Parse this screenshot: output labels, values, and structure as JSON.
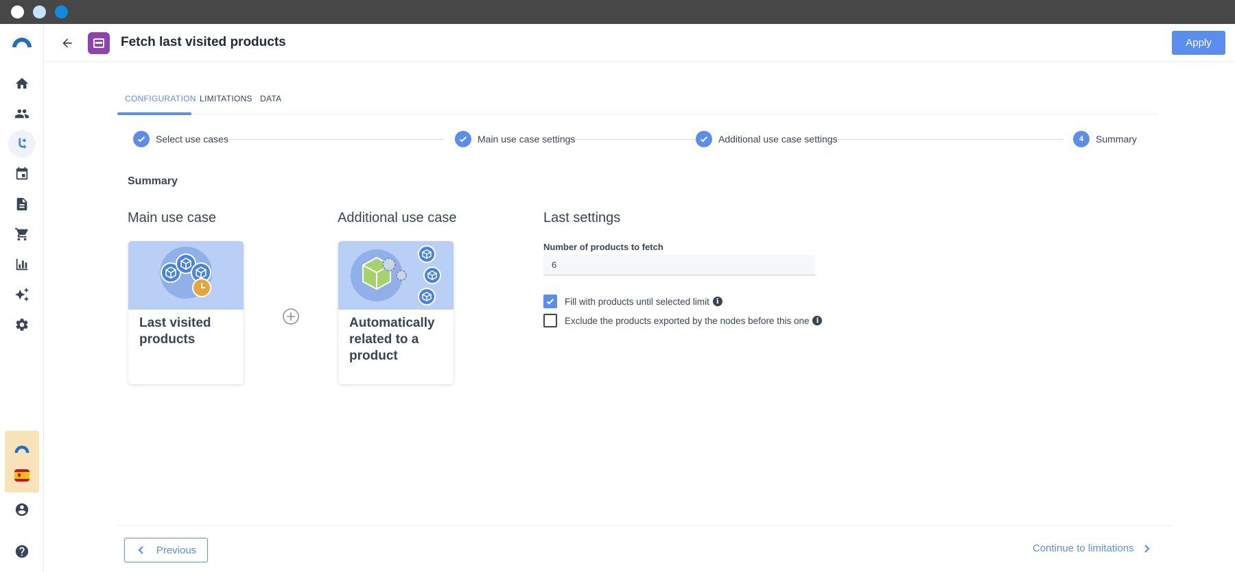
{
  "window": {
    "buttons": [
      "close",
      "minimize",
      "maximize"
    ]
  },
  "sidebar": {
    "logo_icon": "brand-arc-icon",
    "items": [
      {
        "icon": "home-icon"
      },
      {
        "icon": "people-icon"
      },
      {
        "icon": "flow-branch-icon",
        "active": true
      },
      {
        "icon": "calendar-icon"
      },
      {
        "icon": "document-icon"
      },
      {
        "icon": "cart-icon"
      },
      {
        "icon": "bar-chart-icon"
      },
      {
        "icon": "sparkles-icon"
      },
      {
        "icon": "gear-icon"
      }
    ],
    "bottom": [
      {
        "icon": "account-circle-icon"
      },
      {
        "icon": "help-icon"
      }
    ],
    "promo": {
      "flag": "spain-flag"
    }
  },
  "header": {
    "title": "Fetch last visited products",
    "apply_label": "Apply",
    "node_icon": "credit-card-icon",
    "node_color": "#8e44ad"
  },
  "tabs": [
    {
      "label": "CONFIGURATION",
      "active": true
    },
    {
      "label": "LIMITATIONS",
      "active": false
    },
    {
      "label": "DATA",
      "active": false
    }
  ],
  "stepper": {
    "steps": [
      {
        "label": "Select use cases",
        "status": "done"
      },
      {
        "label": "Main use case settings",
        "status": "done"
      },
      {
        "label": "Additional use case settings",
        "status": "done"
      },
      {
        "label": "Summary",
        "status": "current",
        "number": "4"
      }
    ]
  },
  "summary": {
    "title": "Summary",
    "main_use_case": {
      "heading": "Main use case",
      "card_label": "Last visited products"
    },
    "additional_use_case": {
      "heading": "Additional use case",
      "card_label": "Automatically related to a product"
    },
    "last_settings": {
      "heading": "Last settings",
      "number_label": "Number of products to fetch",
      "number_value": "6",
      "fill_label": "Fill with products until selected limit",
      "fill_checked": true,
      "exclude_label": "Exclude the products exported by the nodes before this one",
      "exclude_checked": false
    }
  },
  "footer": {
    "previous_label": "Previous",
    "continue_label": "Continue to limitations"
  },
  "colors": {
    "accent": "#5b8def",
    "text": "#384556",
    "card_bg": "#b9cff5"
  }
}
